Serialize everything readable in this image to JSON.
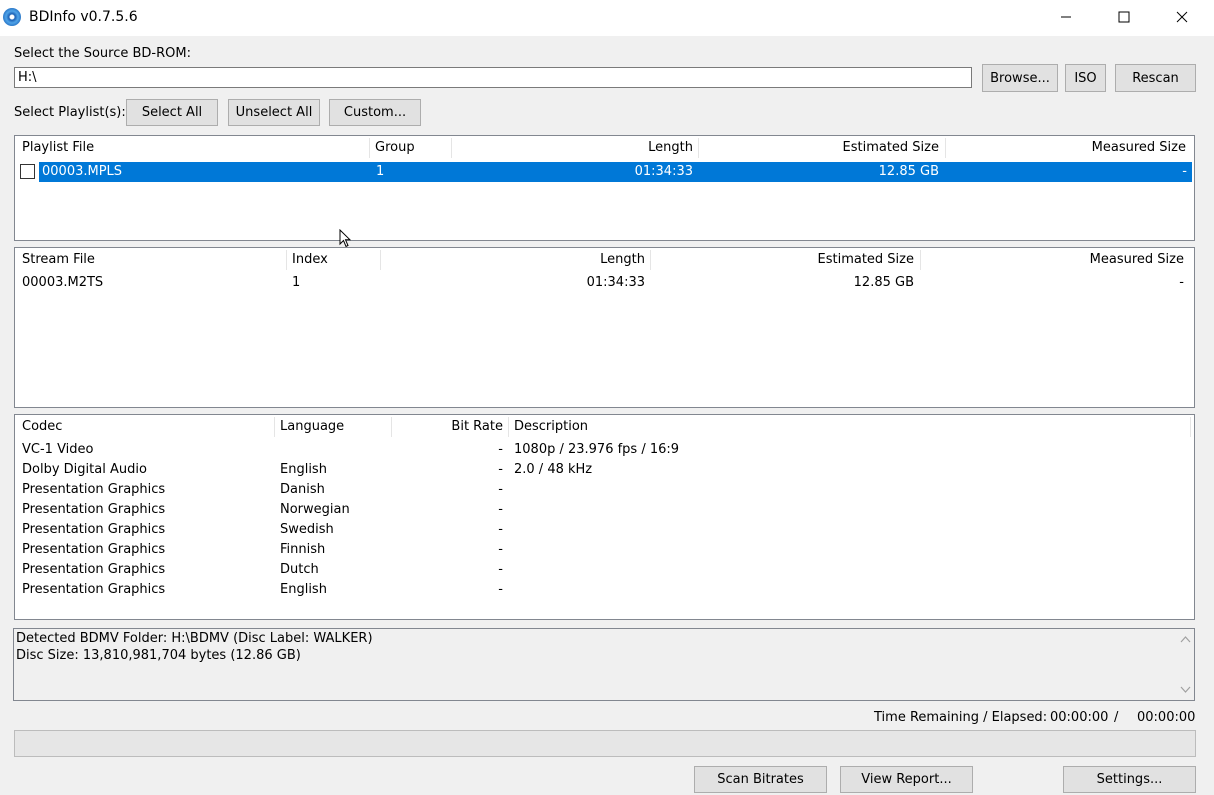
{
  "window": {
    "title": "BDInfo v0.7.5.6",
    "minimize_icon": "minimize-icon",
    "maximize_icon": "maximize-icon",
    "close_icon": "close-icon"
  },
  "source": {
    "label": "Select the Source BD-ROM:",
    "path_value": "H:\\",
    "browse_label": "Browse...",
    "iso_label": "ISO",
    "rescan_label": "Rescan"
  },
  "playlist_select": {
    "label": "Select Playlist(s):",
    "select_all_label": "Select All",
    "unselect_all_label": "Unselect All",
    "custom_label": "Custom..."
  },
  "playlists": {
    "columns": [
      "Playlist File",
      "Group",
      "Length",
      "Estimated Size",
      "Measured Size"
    ],
    "rows": [
      {
        "file": "00003.MPLS",
        "group": "1",
        "length": "01:34:33",
        "estimated_size": "12.85 GB",
        "measured_size": "-",
        "checked": false,
        "selected": true
      }
    ]
  },
  "streams": {
    "columns": [
      "Stream File",
      "Index",
      "Length",
      "Estimated Size",
      "Measured Size"
    ],
    "rows": [
      {
        "file": "00003.M2TS",
        "index": "1",
        "length": "01:34:33",
        "estimated_size": "12.85 GB",
        "measured_size": "-"
      }
    ]
  },
  "codecs": {
    "columns": [
      "Codec",
      "Language",
      "Bit Rate",
      "Description"
    ],
    "rows": [
      {
        "codec": "VC-1 Video",
        "language": "",
        "bitrate": "-",
        "description": "1080p / 23.976 fps / 16:9"
      },
      {
        "codec": "Dolby Digital Audio",
        "language": "English",
        "bitrate": "-",
        "description": "2.0 / 48 kHz"
      },
      {
        "codec": "Presentation Graphics",
        "language": "Danish",
        "bitrate": "-",
        "description": ""
      },
      {
        "codec": "Presentation Graphics",
        "language": "Norwegian",
        "bitrate": "-",
        "description": ""
      },
      {
        "codec": "Presentation Graphics",
        "language": "Swedish",
        "bitrate": "-",
        "description": ""
      },
      {
        "codec": "Presentation Graphics",
        "language": "Finnish",
        "bitrate": "-",
        "description": ""
      },
      {
        "codec": "Presentation Graphics",
        "language": "Dutch",
        "bitrate": "-",
        "description": ""
      },
      {
        "codec": "Presentation Graphics",
        "language": "English",
        "bitrate": "-",
        "description": ""
      }
    ]
  },
  "log": {
    "lines": [
      "Detected BDMV Folder: H:\\BDMV (Disc Label: WALKER)",
      "Disc Size: 13,810,981,704 bytes (12.86 GB)"
    ]
  },
  "status": {
    "time_label": "Time Remaining / Elapsed:",
    "remaining": "00:00:00",
    "separator": "/",
    "elapsed": "00:00:00",
    "progress": 0
  },
  "actions": {
    "scan_bitrates_label": "Scan Bitrates",
    "view_report_label": "View Report...",
    "settings_label": "Settings..."
  },
  "colors": {
    "selection": "#0078d7",
    "window_bg": "#f0f0f0"
  }
}
